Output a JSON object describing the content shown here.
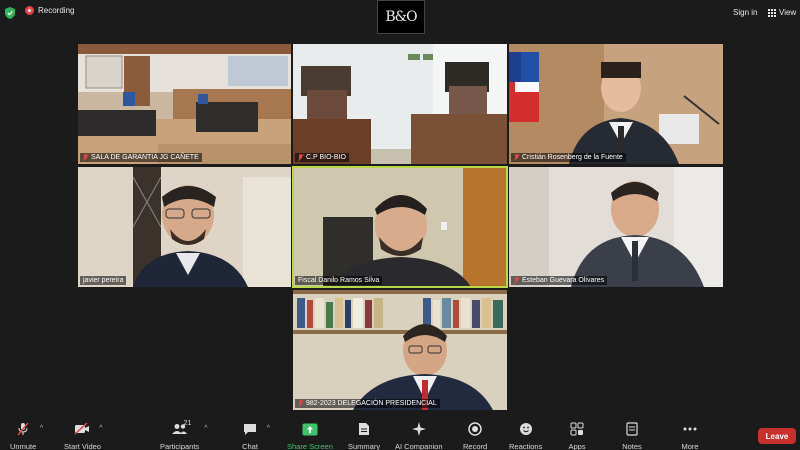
{
  "topbar": {
    "recording_label": "Recording",
    "logo_text": "B&O",
    "signin_label": "Sign in",
    "view_label": "View"
  },
  "participants": [
    {
      "name": "SALA DE GARANTIA JG CAÑETE",
      "muted": true
    },
    {
      "name": "C.P BIO-BIO",
      "muted": true
    },
    {
      "name": "Cristián Rosenberg de la Fuente",
      "muted": true
    },
    {
      "name": "javier pereira",
      "muted": false
    },
    {
      "name": "Fiscal Danilo Ramos Silva",
      "muted": false,
      "active_speaker": true
    },
    {
      "name": "Esteban Guevara Olivares",
      "muted": true
    },
    {
      "name": "982-2023 DELEGACIÓN PRESIDENCIAL",
      "muted": true
    }
  ],
  "toolbar": {
    "unmute_label": "Unmute",
    "start_video_label": "Start Video",
    "participants_label": "Participants",
    "participants_count": "21",
    "chat_label": "Chat",
    "share_screen_label": "Share Screen",
    "summary_label": "Summary",
    "ai_companion_label": "AI Companion",
    "record_label": "Record",
    "reactions_label": "Reactions",
    "apps_label": "Apps",
    "notes_label": "Notes",
    "more_label": "More",
    "leave_label": "Leave"
  },
  "colors": {
    "active_speaker_border": "#b8d84a",
    "leave": "#c8302b",
    "share_screen": "#3ec36a",
    "mute_indicator": "#e04646"
  }
}
